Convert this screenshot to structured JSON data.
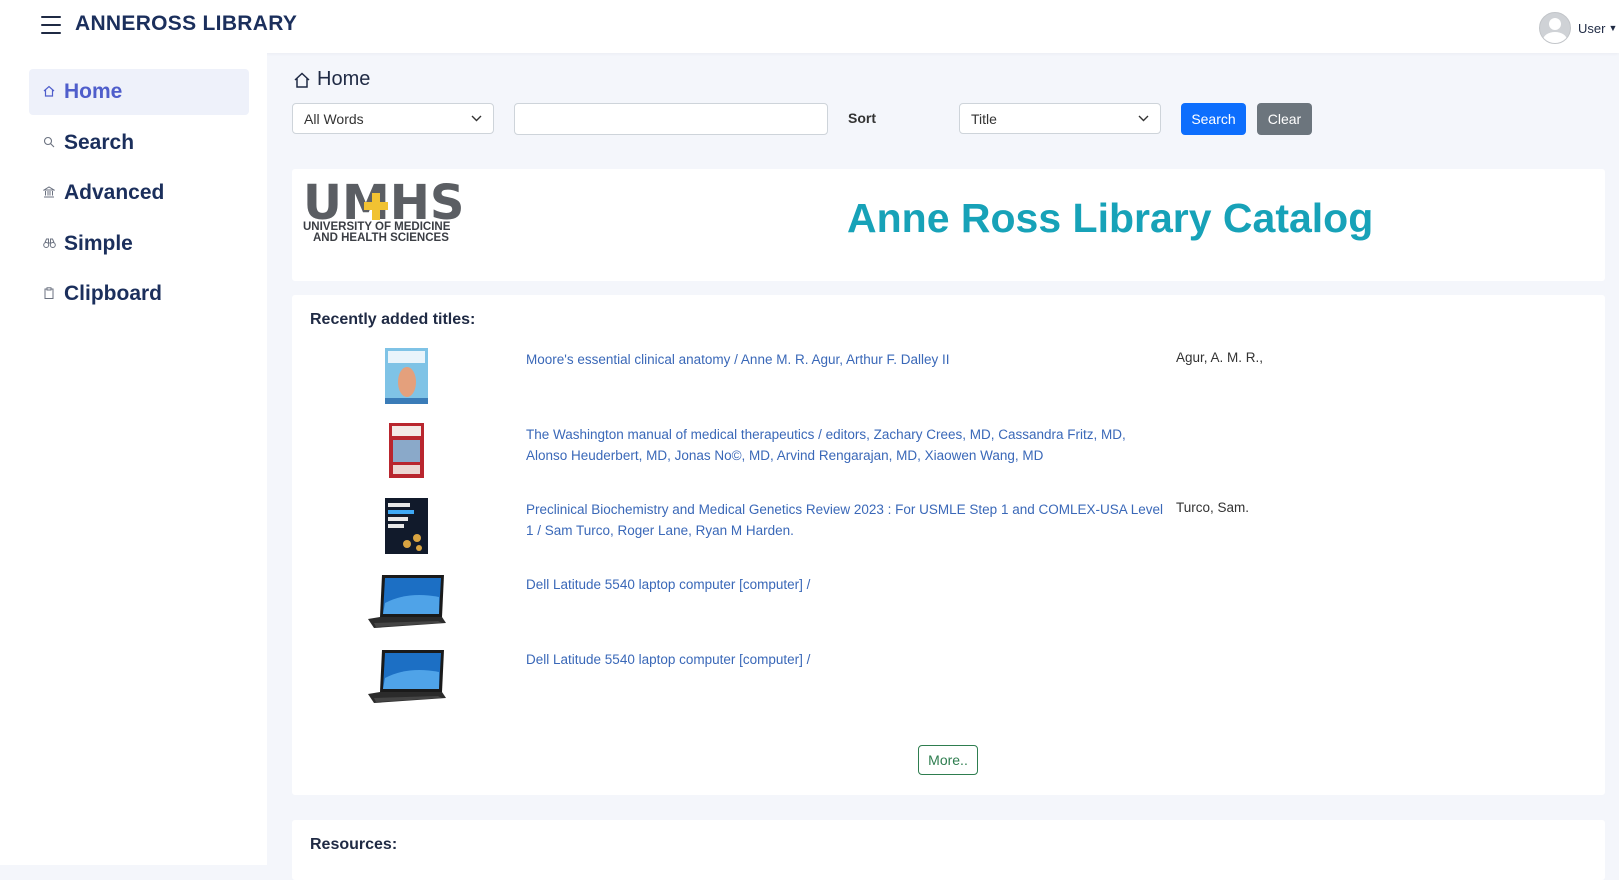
{
  "app": {
    "title": "ANNEROSS LIBRARY"
  },
  "user": {
    "label": "User"
  },
  "sidebar": {
    "items": [
      {
        "label": "Home",
        "icon": "home-icon"
      },
      {
        "label": "Search",
        "icon": "search-icon"
      },
      {
        "label": "Advanced",
        "icon": "bank-icon"
      },
      {
        "label": "Simple",
        "icon": "binoculars-icon"
      },
      {
        "label": "Clipboard",
        "icon": "clipboard-icon"
      }
    ]
  },
  "breadcrumb": {
    "label": "Home"
  },
  "search": {
    "mode_value": "All Words",
    "query": "",
    "sort_label": "Sort",
    "sort_value": "Title",
    "search_label": "Search",
    "clear_label": "Clear"
  },
  "banner": {
    "logo_text": "UMHS",
    "logo_line1": "UNIVERSITY OF MEDICINE",
    "logo_line2": "AND HEALTH SCIENCES",
    "title": "Anne Ross Library Catalog"
  },
  "recent": {
    "heading": "Recently added titles:",
    "items": [
      {
        "title": "Moore's essential clinical anatomy / Anne M. R. Agur, Arthur F. Dalley II",
        "author": "Agur, A. M. R.,",
        "thumb": "book-cover"
      },
      {
        "title": "The Washington manual of medical therapeutics / editors, Zachary Crees, MD, Cassandra Fritz, MD, Alonso Heuderbert, MD, Jonas No©, MD, Arvind Rengarajan, MD, Xiaowen Wang, MD",
        "author": "",
        "thumb": "book-cover"
      },
      {
        "title": "Preclinical Biochemistry and Medical Genetics Review 2023 : For USMLE Step 1 and COMLEX-USA Level 1 / Sam Turco, Roger Lane, Ryan M Harden.",
        "author": "Turco, Sam.",
        "thumb": "book-cover"
      },
      {
        "title": "Dell Latitude 5540 laptop computer [computer] /",
        "author": "",
        "thumb": "laptop"
      },
      {
        "title": "Dell Latitude 5540 laptop computer [computer] /",
        "author": "",
        "thumb": "laptop"
      }
    ],
    "more_label": "More.."
  },
  "resources": {
    "heading": "Resources:"
  },
  "colors": {
    "accent": "#4f5ecb",
    "banner_title": "#17a2b8",
    "link": "#3a68b8",
    "primary_button": "#0d6efd",
    "secondary_button": "#6c757d"
  }
}
